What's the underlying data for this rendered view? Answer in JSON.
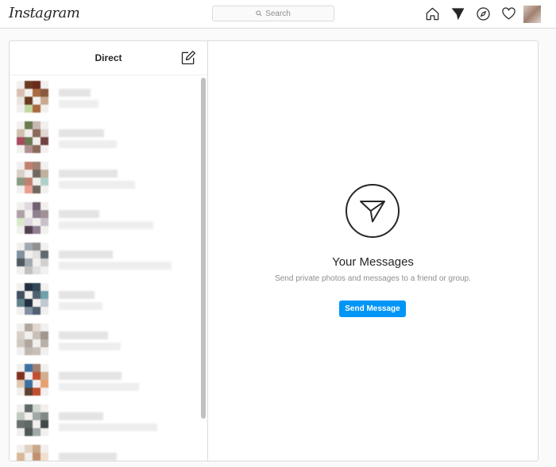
{
  "header": {
    "logo": "Instagram",
    "search_placeholder": "Search"
  },
  "direct": {
    "title": "Direct"
  },
  "empty_state": {
    "title": "Your Messages",
    "subtitle": "Send private photos and messages to a friend or group.",
    "button": "Send Message"
  },
  "colors": {
    "accent": "#0095f6",
    "border": "#dbdbdb"
  }
}
